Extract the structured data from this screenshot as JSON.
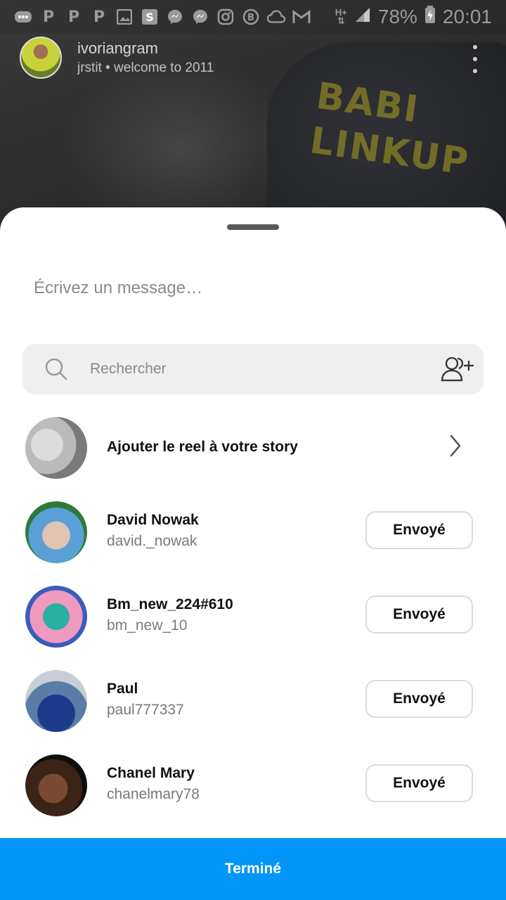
{
  "status_bar": {
    "battery": "78%",
    "time": "20:01",
    "icons": [
      "message-bubble-icon",
      "p-icon",
      "p-icon",
      "p-icon",
      "image-icon",
      "s-app-icon",
      "messenger-icon",
      "messenger-icon",
      "instagram-icon",
      "b-icon",
      "cloud-icon",
      "gmail-icon",
      "signal-hplus-icon",
      "signal-bars-icon",
      "battery-charging-icon"
    ]
  },
  "reel": {
    "username": "ivoriangram",
    "subtitle": "jrstit • welcome to 2011",
    "overlay_text": "BABI\nLINKUP"
  },
  "share_sheet": {
    "message_placeholder": "Écrivez un message…",
    "search_placeholder": "Rechercher",
    "story_row_label": "Ajouter le reel à votre story",
    "contacts": [
      {
        "name": "David Nowak",
        "username": "david._nowak",
        "button": "Envoyé"
      },
      {
        "name": "Bm_new_224#610",
        "username": "bm_new_10",
        "button": "Envoyé"
      },
      {
        "name": "Paul",
        "username": "paul777337",
        "button": "Envoyé"
      },
      {
        "name": "Chanel Mary",
        "username": "chanelmary78",
        "button": "Envoyé"
      }
    ],
    "done_label": "Terminé"
  },
  "colors": {
    "accent": "#0095f6",
    "sheet_bg": "#ffffff",
    "search_bg": "#efefef"
  }
}
